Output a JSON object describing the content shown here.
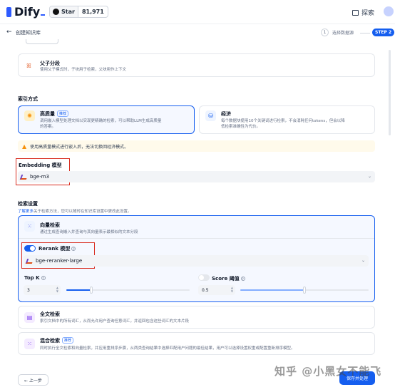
{
  "header": {
    "brand": "Dify",
    "github_label": "Star",
    "github_stars": "81,971",
    "explore_label": "探索"
  },
  "subheader": {
    "back_title": "创建知识库",
    "step1_num": "1",
    "step1_label": "选择数据源",
    "step2_label": "STEP 2"
  },
  "parent_child": {
    "title": "父子分段",
    "desc": "使用父子模式时，子块用于检索，父块用作上下文"
  },
  "index_method": {
    "section_title": "索引方式",
    "high_quality": {
      "title": "高质量",
      "badge": "推荐",
      "desc1": "调用嵌入模型处理文档以实现更精确的检索，可以帮助LLM生成高质量",
      "desc2": "的答案。"
    },
    "economy": {
      "title": "经济",
      "desc1": "每个数据块使用10个关键词进行检索，不会消耗任何tokens，但会以降",
      "desc2": "低检索准确性为代价。"
    },
    "warning": "使用高质量模式进行嵌入后，无法切换回经济模式。"
  },
  "embedding": {
    "label": "Embedding 模型",
    "model": "bge-m3"
  },
  "retrieval": {
    "section_title": "检索设置",
    "link_prefix": "了解更多",
    "link_rest": "关于检索方法，您可以随时在知识库设置中更改此设置。",
    "vector": {
      "title": "向量检索",
      "desc": "通过生成查询嵌入并查询与其向量表示最相似的文本分段"
    },
    "rerank": {
      "label": "Rerank 模型",
      "model": "bge-reranker-large",
      "enabled": true
    },
    "top_k": {
      "label": "Top K",
      "value": "3",
      "slider_fraction": 0.2
    },
    "score_threshold": {
      "label": "Score 阈值",
      "value": "0.5",
      "enabled": false,
      "slider_fraction": 0.5
    },
    "fulltext": {
      "title": "全文检索",
      "desc": "索引文档中的所有词汇，从而允许用户查询任意词汇，并返回包含这些词汇的文本片段"
    },
    "hybrid": {
      "title": "混合检索",
      "badge": "推荐",
      "desc": "同时执行全文检索和向量检索，并应用重排序步骤，从两类查询结果中选择匹配用户问题的最佳结果，用户可以选择设置权重或配置重新排序模型。"
    }
  },
  "footer": {
    "prev_label": "← 上一步",
    "next_label": "保存并处理"
  },
  "watermark": "知乎 @小黑女不能飞",
  "colors": {
    "accent": "#155eef",
    "highlight_border": "#d92d20",
    "warning": "#f79009"
  }
}
